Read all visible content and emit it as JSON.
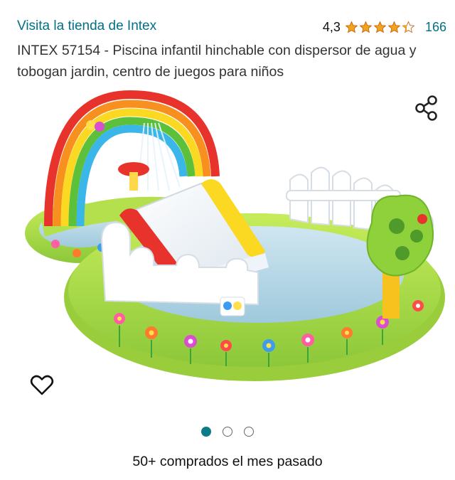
{
  "store_link": "Visita la tienda de Intex",
  "rating": {
    "value_text": "4,3",
    "stars_value": 4.3,
    "count": "166",
    "star_color": "#f0a51c"
  },
  "product_title": "INTEX 57154 - Piscina infantil hinchable con dispersor de agua y tobogan jardin, centro de juegos para niños",
  "icons": {
    "share": "share-icon",
    "wishlist": "heart-outline-icon"
  },
  "carousel": {
    "total": 3,
    "active": 1
  },
  "purchase_note": "50+ comprados el mes pasado",
  "colors": {
    "link": "#007185",
    "active_dot": "#0e7b8a"
  }
}
